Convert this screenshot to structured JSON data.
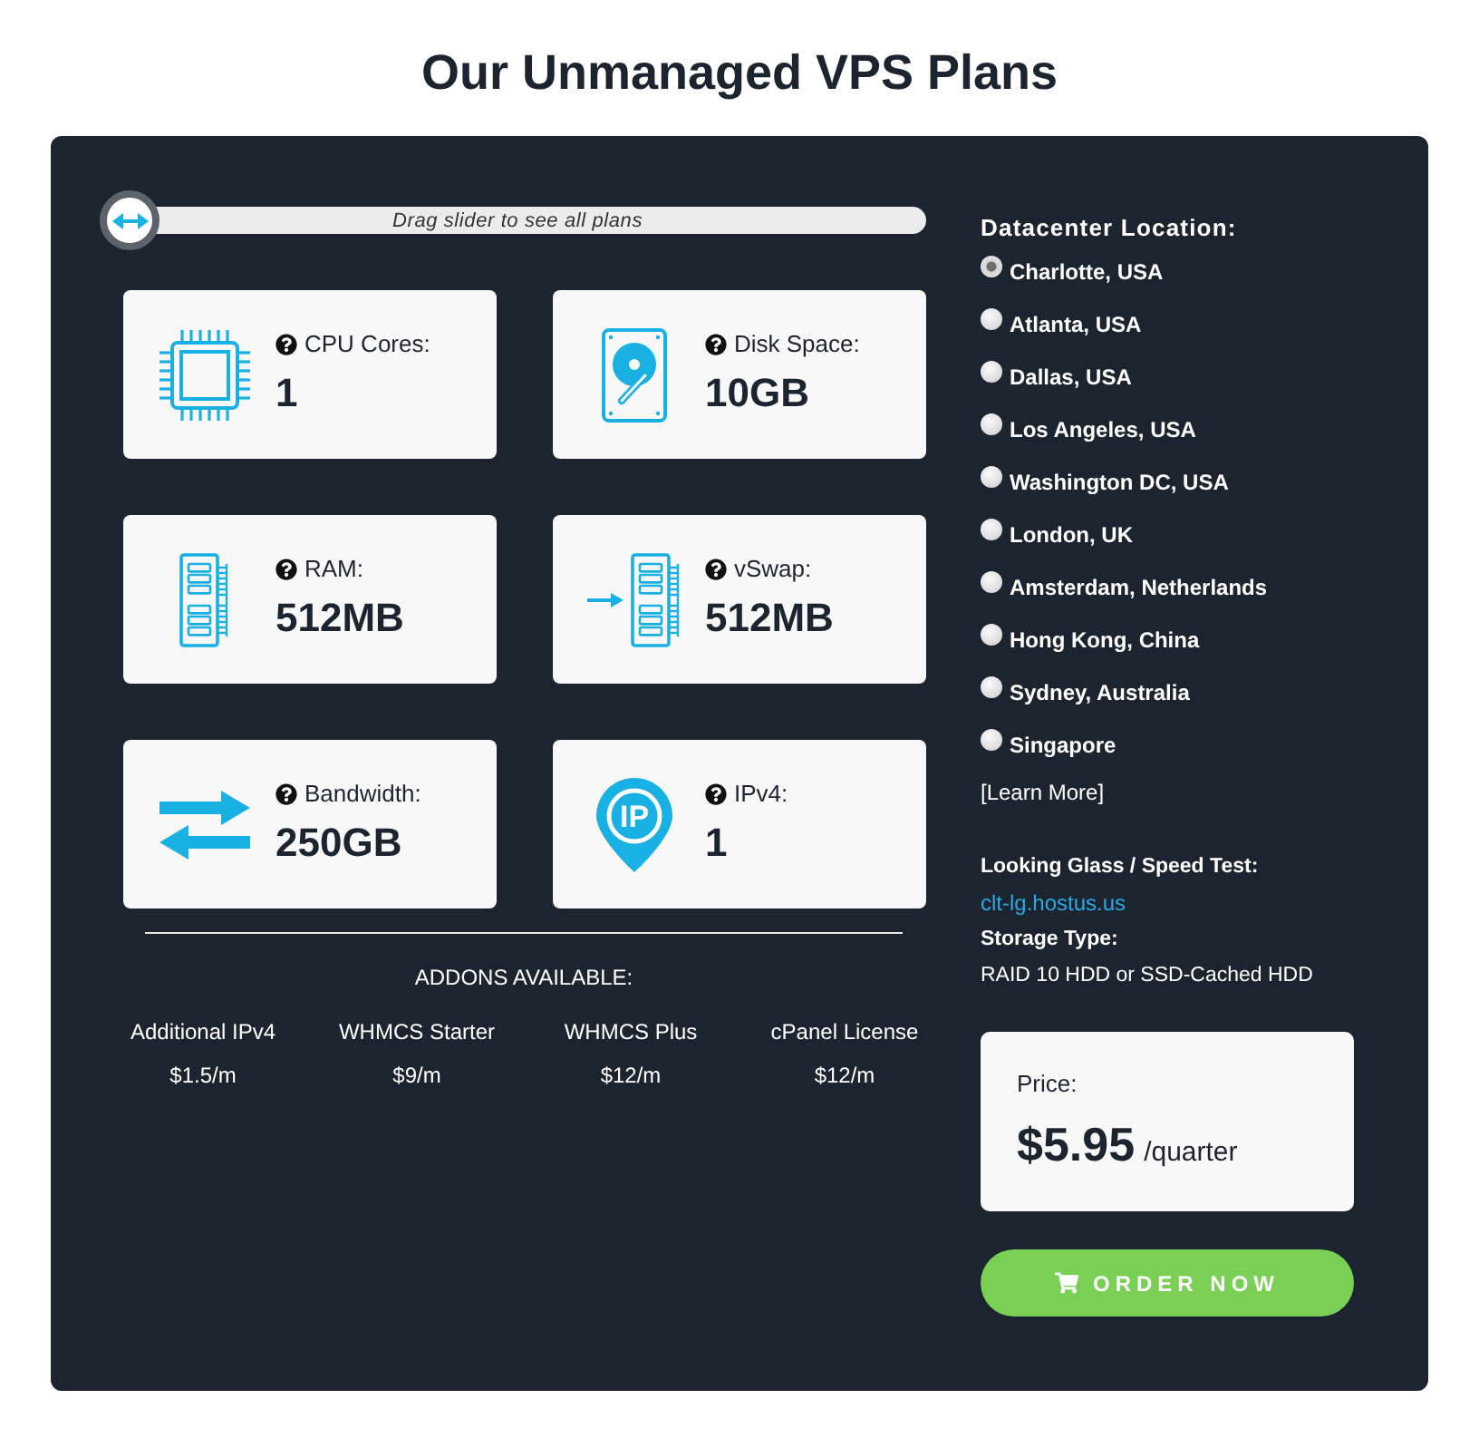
{
  "title": "Our Unmanaged VPS Plans",
  "slider": {
    "hint": "Drag slider to see all plans",
    "level": 0
  },
  "specs": [
    {
      "kind": "cpu",
      "label": "CPU Cores:",
      "value": "1"
    },
    {
      "kind": "disk",
      "label": "Disk Space:",
      "value": "10GB"
    },
    {
      "kind": "ram",
      "label": "RAM:",
      "value": "512MB"
    },
    {
      "kind": "swap",
      "label": "vSwap:",
      "value": "512MB"
    },
    {
      "kind": "bandwidth",
      "label": "Bandwidth:",
      "value": "250GB"
    },
    {
      "kind": "ip",
      "label": "IPv4:",
      "value": "1",
      "icon_text": "IP"
    }
  ],
  "addons": {
    "heading": "ADDONS AVAILABLE:",
    "items": [
      {
        "name": "Additional IPv4",
        "price": "$1.5/m"
      },
      {
        "name": "WHMCS Starter",
        "price": "$9/m"
      },
      {
        "name": "WHMCS Plus",
        "price": "$12/m"
      },
      {
        "name": "cPanel License",
        "price": "$12/m"
      }
    ]
  },
  "datacenter": {
    "heading": "Datacenter Location:",
    "options": [
      {
        "label": "Charlotte, USA",
        "selected": true
      },
      {
        "label": "Atlanta, USA",
        "selected": false
      },
      {
        "label": "Dallas, USA",
        "selected": false
      },
      {
        "label": "Los Angeles, USA",
        "selected": false
      },
      {
        "label": "Washington DC, USA",
        "selected": false
      },
      {
        "label": "London, UK",
        "selected": false
      },
      {
        "label": "Amsterdam, Netherlands",
        "selected": false
      },
      {
        "label": "Hong Kong, China",
        "selected": false
      },
      {
        "label": "Sydney, Australia",
        "selected": false
      },
      {
        "label": "Singapore",
        "selected": false
      }
    ],
    "learn_more": "[Learn More]"
  },
  "looking_glass": {
    "label": "Looking Glass / Speed Test:",
    "link": "clt-lg.hostus.us"
  },
  "storage": {
    "label": "Storage Type:",
    "value": "RAID 10 HDD or SSD-Cached HDD"
  },
  "price": {
    "label": "Price:",
    "amount": "$5.95",
    "period": "/quarter"
  },
  "order_button": "ORDER NOW"
}
